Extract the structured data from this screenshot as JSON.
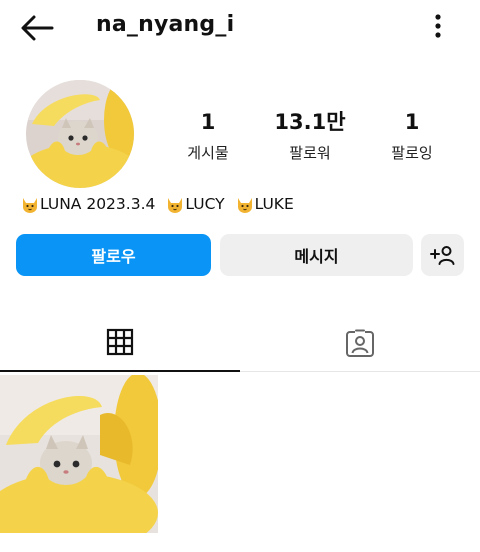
{
  "header": {
    "username": "na_nyang_i"
  },
  "stats": {
    "posts": {
      "count": "1",
      "label": "게시물"
    },
    "followers": {
      "count": "13.1만",
      "label": "팔로워"
    },
    "following": {
      "count": "1",
      "label": "팔로잉"
    }
  },
  "bio": {
    "luna": "LUNA 2023.3.4",
    "lucy": "LUCY",
    "luke": "LUKE",
    "emoji_icon": "cat-face-icon"
  },
  "actions": {
    "follow_label": "팔로우",
    "message_label": "메시지",
    "suggest_icon": "add-person-icon"
  },
  "tabs": [
    {
      "icon": "grid-icon",
      "active": true
    },
    {
      "icon": "tagged-person-icon",
      "active": false
    }
  ],
  "colors": {
    "follow_button": "#0a95f6",
    "secondary_button": "#efefef",
    "banana": "#f4d34a"
  }
}
